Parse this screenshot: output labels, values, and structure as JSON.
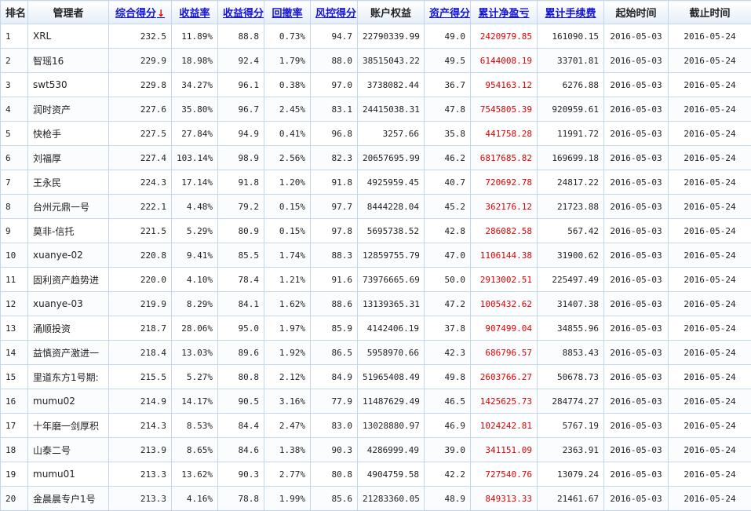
{
  "headers": {
    "rank": "排名",
    "manager": "管理者",
    "score": "综合得分",
    "sort_arrow": "↓",
    "return_rate": "收益率",
    "return_score": "收益得分",
    "drawdown": "回撤率",
    "risk_score": "风控得分",
    "equity": "账户权益",
    "asset_score": "资产得分",
    "net_pnl": "累计净盈亏",
    "fees": "累计手续费",
    "start": "起始时间",
    "end": "截止时间"
  },
  "rows": [
    {
      "rank": "1",
      "manager": "XRL",
      "score": "232.5",
      "return_rate": "11.89%",
      "return_score": "88.8",
      "drawdown": "0.73%",
      "risk_score": "94.7",
      "equity": "22790339.99",
      "asset_score": "49.0",
      "net_pnl": "2420979.85",
      "fees": "161090.15",
      "start": "2016-05-03",
      "end": "2016-05-24"
    },
    {
      "rank": "2",
      "manager": "智瑶16",
      "score": "229.9",
      "return_rate": "18.98%",
      "return_score": "92.4",
      "drawdown": "1.79%",
      "risk_score": "88.0",
      "equity": "38515043.22",
      "asset_score": "49.5",
      "net_pnl": "6144008.19",
      "fees": "33701.81",
      "start": "2016-05-03",
      "end": "2016-05-24"
    },
    {
      "rank": "3",
      "manager": "swt530",
      "score": "229.8",
      "return_rate": "34.27%",
      "return_score": "96.1",
      "drawdown": "0.38%",
      "risk_score": "97.0",
      "equity": "3738082.44",
      "asset_score": "36.7",
      "net_pnl": "954163.12",
      "fees": "6276.88",
      "start": "2016-05-03",
      "end": "2016-05-24"
    },
    {
      "rank": "4",
      "manager": "润时资产",
      "score": "227.6",
      "return_rate": "35.80%",
      "return_score": "96.7",
      "drawdown": "2.45%",
      "risk_score": "83.1",
      "equity": "24415038.31",
      "asset_score": "47.8",
      "net_pnl": "7545805.39",
      "fees": "920959.61",
      "start": "2016-05-03",
      "end": "2016-05-24"
    },
    {
      "rank": "5",
      "manager": "快枪手",
      "score": "227.5",
      "return_rate": "27.84%",
      "return_score": "94.9",
      "drawdown": "0.41%",
      "risk_score": "96.8",
      "equity": "3257.66",
      "asset_score": "35.8",
      "net_pnl": "441758.28",
      "fees": "11991.72",
      "start": "2016-05-03",
      "end": "2016-05-24"
    },
    {
      "rank": "6",
      "manager": "刘福厚",
      "score": "227.4",
      "return_rate": "103.14%",
      "return_score": "98.9",
      "drawdown": "2.56%",
      "risk_score": "82.3",
      "equity": "20657695.99",
      "asset_score": "46.2",
      "net_pnl": "6817685.82",
      "fees": "169699.18",
      "start": "2016-05-03",
      "end": "2016-05-24"
    },
    {
      "rank": "7",
      "manager": "王永民",
      "score": "224.3",
      "return_rate": "17.14%",
      "return_score": "91.8",
      "drawdown": "1.20%",
      "risk_score": "91.8",
      "equity": "4925959.45",
      "asset_score": "40.7",
      "net_pnl": "720692.78",
      "fees": "24817.22",
      "start": "2016-05-03",
      "end": "2016-05-24"
    },
    {
      "rank": "8",
      "manager": "台州元鼎一号",
      "score": "222.1",
      "return_rate": "4.48%",
      "return_score": "79.2",
      "drawdown": "0.15%",
      "risk_score": "97.7",
      "equity": "8444228.04",
      "asset_score": "45.2",
      "net_pnl": "362176.12",
      "fees": "21723.88",
      "start": "2016-05-03",
      "end": "2016-05-24"
    },
    {
      "rank": "9",
      "manager": "莫非-信托",
      "score": "221.5",
      "return_rate": "5.29%",
      "return_score": "80.9",
      "drawdown": "0.15%",
      "risk_score": "97.8",
      "equity": "5695738.52",
      "asset_score": "42.8",
      "net_pnl": "286082.58",
      "fees": "567.42",
      "start": "2016-05-03",
      "end": "2016-05-24"
    },
    {
      "rank": "10",
      "manager": "xuanye-02",
      "score": "220.8",
      "return_rate": "9.41%",
      "return_score": "85.5",
      "drawdown": "1.74%",
      "risk_score": "88.3",
      "equity": "12859755.79",
      "asset_score": "47.0",
      "net_pnl": "1106144.38",
      "fees": "31900.62",
      "start": "2016-05-03",
      "end": "2016-05-24"
    },
    {
      "rank": "11",
      "manager": "固利资产趋势进",
      "score": "220.0",
      "return_rate": "4.10%",
      "return_score": "78.4",
      "drawdown": "1.21%",
      "risk_score": "91.6",
      "equity": "73976665.69",
      "asset_score": "50.0",
      "net_pnl": "2913002.51",
      "fees": "225497.49",
      "start": "2016-05-03",
      "end": "2016-05-24"
    },
    {
      "rank": "12",
      "manager": "xuanye-03",
      "score": "219.9",
      "return_rate": "8.29%",
      "return_score": "84.1",
      "drawdown": "1.62%",
      "risk_score": "88.6",
      "equity": "13139365.31",
      "asset_score": "47.2",
      "net_pnl": "1005432.62",
      "fees": "31407.38",
      "start": "2016-05-03",
      "end": "2016-05-24"
    },
    {
      "rank": "13",
      "manager": "涌顺投资",
      "score": "218.7",
      "return_rate": "28.06%",
      "return_score": "95.0",
      "drawdown": "1.97%",
      "risk_score": "85.9",
      "equity": "4142406.19",
      "asset_score": "37.8",
      "net_pnl": "907499.04",
      "fees": "34855.96",
      "start": "2016-05-03",
      "end": "2016-05-24"
    },
    {
      "rank": "14",
      "manager": "益慎资产激进一",
      "score": "218.4",
      "return_rate": "13.03%",
      "return_score": "89.6",
      "drawdown": "1.92%",
      "risk_score": "86.5",
      "equity": "5958970.66",
      "asset_score": "42.3",
      "net_pnl": "686796.57",
      "fees": "8853.43",
      "start": "2016-05-03",
      "end": "2016-05-24"
    },
    {
      "rank": "15",
      "manager": "里道东方1号期:",
      "score": "215.5",
      "return_rate": "5.27%",
      "return_score": "80.8",
      "drawdown": "2.12%",
      "risk_score": "84.9",
      "equity": "51965408.49",
      "asset_score": "49.8",
      "net_pnl": "2603766.27",
      "fees": "50678.73",
      "start": "2016-05-03",
      "end": "2016-05-24"
    },
    {
      "rank": "16",
      "manager": "mumu02",
      "score": "214.9",
      "return_rate": "14.17%",
      "return_score": "90.5",
      "drawdown": "3.16%",
      "risk_score": "77.9",
      "equity": "11487629.49",
      "asset_score": "46.5",
      "net_pnl": "1425625.73",
      "fees": "284774.27",
      "start": "2016-05-03",
      "end": "2016-05-24"
    },
    {
      "rank": "17",
      "manager": "十年磨一剑厚积",
      "score": "214.3",
      "return_rate": "8.53%",
      "return_score": "84.4",
      "drawdown": "2.47%",
      "risk_score": "83.0",
      "equity": "13028880.97",
      "asset_score": "46.9",
      "net_pnl": "1024242.81",
      "fees": "5767.19",
      "start": "2016-05-03",
      "end": "2016-05-24"
    },
    {
      "rank": "18",
      "manager": "山泰二号",
      "score": "213.9",
      "return_rate": "8.65%",
      "return_score": "84.6",
      "drawdown": "1.38%",
      "risk_score": "90.3",
      "equity": "4286999.49",
      "asset_score": "39.0",
      "net_pnl": "341151.09",
      "fees": "2363.91",
      "start": "2016-05-03",
      "end": "2016-05-24"
    },
    {
      "rank": "19",
      "manager": "mumu01",
      "score": "213.3",
      "return_rate": "13.62%",
      "return_score": "90.3",
      "drawdown": "2.77%",
      "risk_score": "80.8",
      "equity": "4904759.58",
      "asset_score": "42.2",
      "net_pnl": "727540.76",
      "fees": "13079.24",
      "start": "2016-05-03",
      "end": "2016-05-24"
    },
    {
      "rank": "20",
      "manager": "金晨晨专户1号",
      "score": "213.3",
      "return_rate": "4.16%",
      "return_score": "78.8",
      "drawdown": "1.99%",
      "risk_score": "85.6",
      "equity": "21283360.05",
      "asset_score": "48.9",
      "net_pnl": "849313.33",
      "fees": "21461.67",
      "start": "2016-05-03",
      "end": "2016-05-24"
    }
  ],
  "colors": {
    "header_link": "#1515d6",
    "pnl": "#e00000",
    "border": "#c4d6ea"
  }
}
